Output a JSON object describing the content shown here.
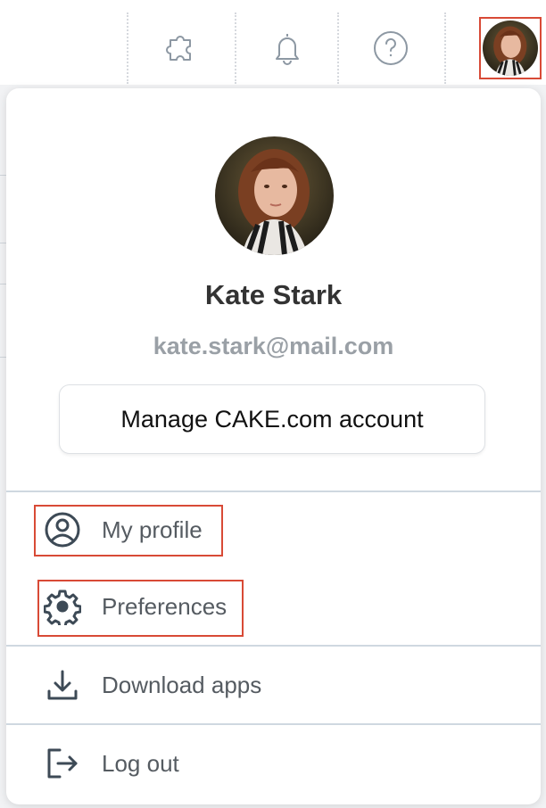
{
  "topbar": {
    "icons": [
      "puzzle-icon",
      "bell-icon",
      "help-icon"
    ],
    "avatar": "user-avatar"
  },
  "account": {
    "name": "Kate Stark",
    "email": "kate.stark@mail.com",
    "manage_label": "Manage CAKE.com account"
  },
  "menu": {
    "items": [
      {
        "label": "My profile",
        "icon": "user-circle-icon"
      },
      {
        "label": "Preferences",
        "icon": "gear-icon"
      },
      {
        "label": "Download apps",
        "icon": "download-icon"
      },
      {
        "label": "Log out",
        "icon": "logout-icon"
      }
    ]
  },
  "colors": {
    "highlight": "#d84a36",
    "icon": "#3d4a56",
    "muted_text": "#9aa0a6"
  }
}
